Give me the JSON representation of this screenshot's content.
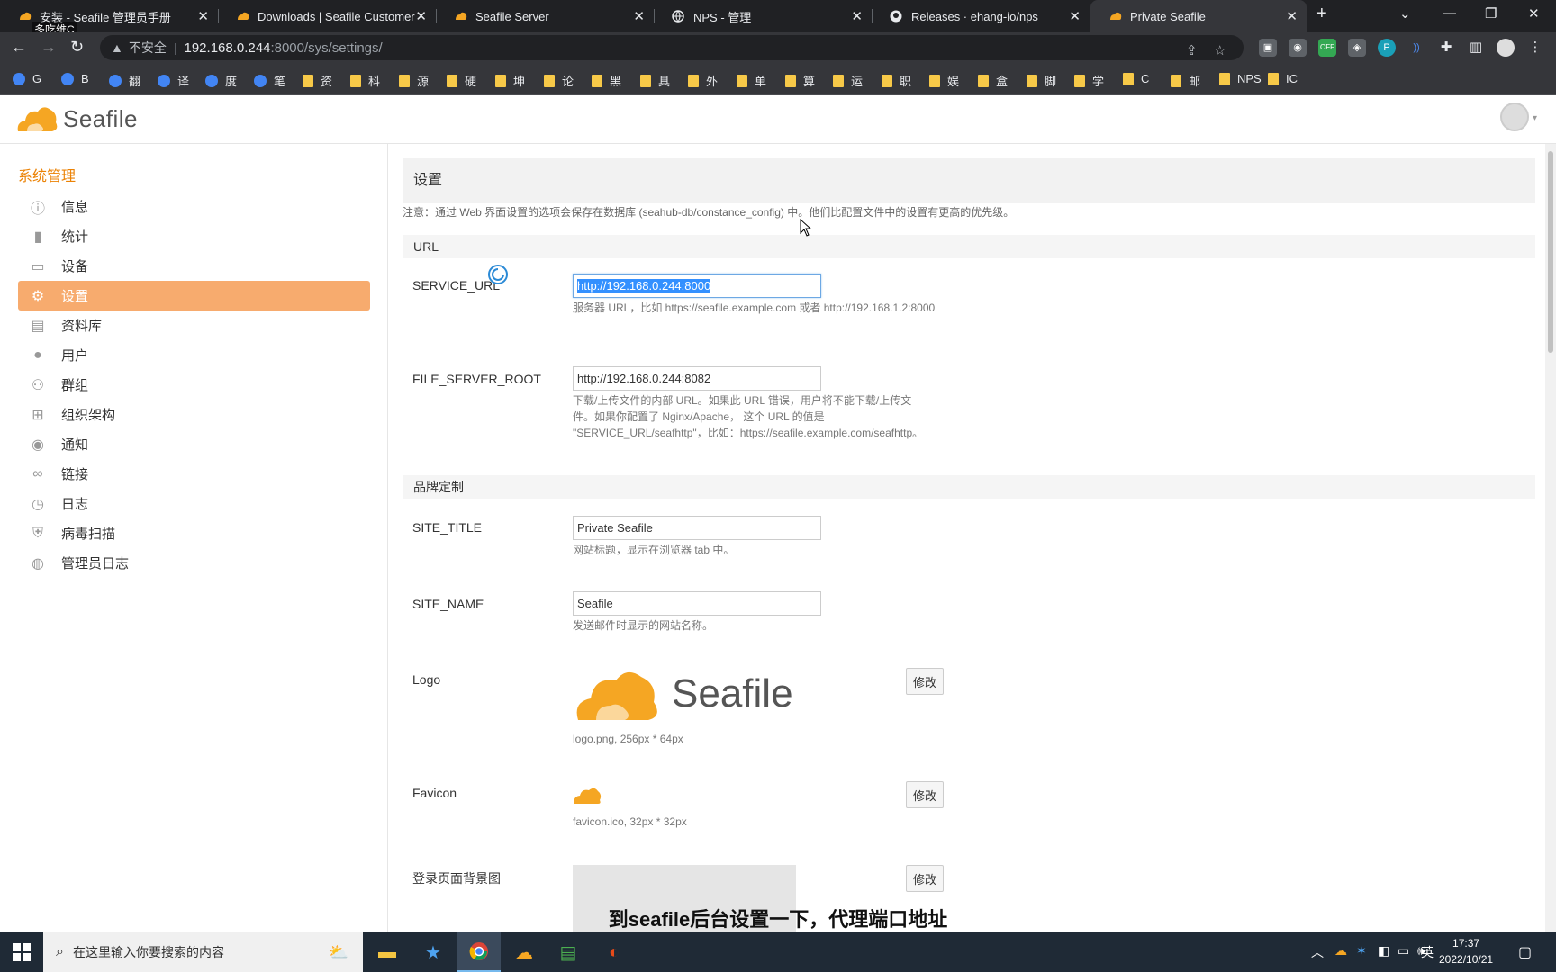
{
  "browser": {
    "tabs": [
      {
        "title": "安装 - Seafile 管理员手册",
        "icon": "seafile-icon"
      },
      {
        "title": "Downloads | Seafile Customer",
        "icon": "seafile-icon"
      },
      {
        "title": "Seafile Server",
        "icon": "seafile-icon"
      },
      {
        "title": "NPS - 管理",
        "icon": "globe-icon"
      },
      {
        "title": "Releases · ehang-io/nps",
        "icon": "github-icon"
      },
      {
        "title": "Private Seafile",
        "icon": "seafile-icon"
      }
    ],
    "overlay_name": "多吃维C",
    "address": {
      "security_label": "不安全",
      "host": "192.168.0.244",
      "path": ":8000/sys/settings/"
    },
    "extension_badge": "OFF",
    "bookmarks": [
      "G",
      "B",
      "翻",
      "译",
      "度",
      "笔",
      "资",
      "科",
      "源",
      "硬",
      "坤",
      "论",
      "黑",
      "具",
      "外",
      "单",
      "算",
      "运",
      "职",
      "娱",
      "盒",
      "脚",
      "学",
      "C",
      "邮",
      "NPS",
      "IC"
    ]
  },
  "app": {
    "logo_text": "Seafile"
  },
  "sidebar": {
    "heading": "系统管理",
    "items": [
      {
        "label": "信息",
        "icon": "info-icon"
      },
      {
        "label": "统计",
        "icon": "bar-chart-icon"
      },
      {
        "label": "设备",
        "icon": "monitor-icon"
      },
      {
        "label": "设置",
        "icon": "gear-icon",
        "active": true
      },
      {
        "label": "资料库",
        "icon": "library-icon"
      },
      {
        "label": "用户",
        "icon": "user-icon"
      },
      {
        "label": "群组",
        "icon": "group-icon"
      },
      {
        "label": "组织架构",
        "icon": "org-chart-icon"
      },
      {
        "label": "通知",
        "icon": "chat-icon"
      },
      {
        "label": "链接",
        "icon": "link-icon"
      },
      {
        "label": "日志",
        "icon": "history-icon"
      },
      {
        "label": "病毒扫描",
        "icon": "shield-icon"
      },
      {
        "label": "管理员日志",
        "icon": "admin-log-icon"
      }
    ]
  },
  "settings": {
    "title": "设置",
    "note": "注意：通过 Web 界面设置的选项会保存在数据库 (seahub-db/constance_config) 中。他们比配置文件中的设置有更高的优先级。",
    "url_group": "URL",
    "service_url": {
      "label": "SERVICE_URL",
      "value": "http://192.168.0.244:8000",
      "help": "服务器 URL，比如 https://seafile.example.com 或者 http://192.168.1.2:8000"
    },
    "file_server_root": {
      "label": "FILE_SERVER_ROOT",
      "value": "http://192.168.0.244:8082",
      "help": "下载/上传文件的内部 URL。如果此 URL 错误，用户将不能下载/上传文件。如果你配置了 Nginx/Apache， 这个 URL 的值是 \"SERVICE_URL/seafhttp\"，比如：https://seafile.example.com/seafhttp。"
    },
    "branding_group": "品牌定制",
    "site_title": {
      "label": "SITE_TITLE",
      "value": "Private Seafile",
      "help": "网站标题，显示在浏览器 tab 中。"
    },
    "site_name": {
      "label": "SITE_NAME",
      "value": "Seafile",
      "help": "发送邮件时显示的网站名称。"
    },
    "logo": {
      "label": "Logo",
      "preview_text": "Seafile",
      "info": "logo.png, 256px * 64px",
      "button": "修改"
    },
    "favicon": {
      "label": "Favicon",
      "info": "favicon.ico, 32px * 32px",
      "button": "修改"
    },
    "login_bg": {
      "label": "登录页面背景图",
      "button": "修改"
    }
  },
  "subtitle": "到seafile后台设置一下，代理端口地址",
  "taskbar": {
    "search_placeholder": "在这里输入你要搜索的内容",
    "ime": "英",
    "time": "17:37",
    "date": "2022/10/21"
  },
  "colors": {
    "accent": "#eb8205",
    "active_bg": "#f7ab6e",
    "chrome_dark": "#202124",
    "chrome_mid": "#35363a"
  }
}
